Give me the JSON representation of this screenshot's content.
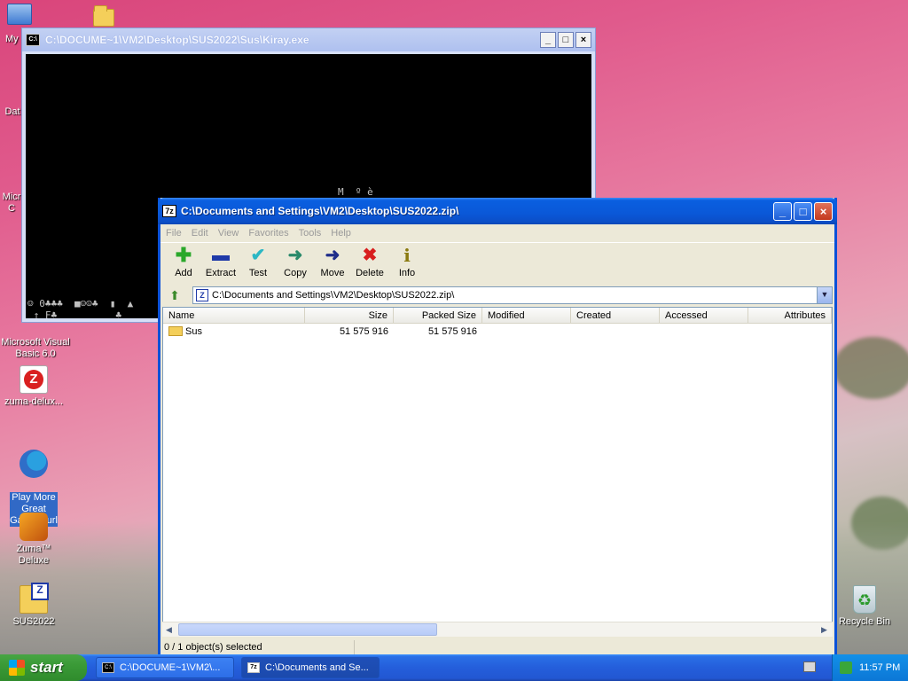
{
  "desktop": {
    "icons": [
      {
        "label": "My"
      },
      {
        "label": "Dat"
      },
      {
        "label": "Micr\nC"
      },
      {
        "label": "Microsoft Visual\nBasic 6.0"
      },
      {
        "label": "zuma-delux..."
      },
      {
        "label": "Play More\nGreat\nGames!.url"
      },
      {
        "label": "Zuma™ Deluxe"
      },
      {
        "label": "SUS2022"
      },
      {
        "label": "Recycle Bin"
      }
    ]
  },
  "console": {
    "title": "C:\\DOCUME~1\\VM2\\Desktop\\SUS2022\\Sus\\Kiray.exe",
    "icon_text": "C:\\",
    "buttons": {
      "minimize": "_",
      "maximize": "□",
      "close": "×"
    },
    "lines": {
      "mid": "M  º è",
      "bottom1": "☺ 0♣♣♣  ■☺☺♣  ▮  ▲",
      "bottom2": " ↑ F♣          ♣"
    }
  },
  "sevenzip": {
    "title": "C:\\Documents and Settings\\VM2\\Desktop\\SUS2022.zip\\",
    "icon_text": "7z",
    "buttons": {
      "minimize": "_",
      "maximize": "□",
      "close": "×"
    },
    "menu": [
      "File",
      "Edit",
      "View",
      "Favorites",
      "Tools",
      "Help"
    ],
    "toolbar": [
      {
        "label": "Add",
        "icon": "plus-icon",
        "glyph": "✚",
        "color": "#2aa82a"
      },
      {
        "label": "Extract",
        "icon": "minus-icon",
        "glyph": "▬",
        "color": "#1f3aa8"
      },
      {
        "label": "Test",
        "icon": "check-icon",
        "glyph": "✔",
        "color": "#2bb7c4"
      },
      {
        "label": "Copy",
        "icon": "copy-arrow-icon",
        "glyph": "➜",
        "color": "#2a8a6a"
      },
      {
        "label": "Move",
        "icon": "move-arrow-icon",
        "glyph": "➜",
        "color": "#1f2d8a"
      },
      {
        "label": "Delete",
        "icon": "delete-x-icon",
        "glyph": "✖",
        "color": "#d81e1e"
      },
      {
        "label": "Info",
        "icon": "info-icon",
        "glyph": "i",
        "color": "#8a7a10"
      }
    ],
    "address": "C:\\Documents and Settings\\VM2\\Desktop\\SUS2022.zip\\",
    "columns": [
      "Name",
      "Size",
      "Packed Size",
      "Modified",
      "Created",
      "Accessed",
      "Attributes"
    ],
    "rows": [
      {
        "name": "Sus",
        "size": "51 575 916",
        "packed": "51 575 916",
        "modified": "",
        "created": "",
        "accessed": "",
        "attributes": ""
      }
    ],
    "status": "0 / 1 object(s) selected"
  },
  "taskbar": {
    "start_label": "start",
    "tasks": [
      {
        "label": "C:\\DOCUME~1\\VM2\\...",
        "icon_text": "C:\\"
      },
      {
        "label": "C:\\Documents and Se...",
        "icon_text": "7z"
      }
    ],
    "clock": "11:57 PM"
  }
}
